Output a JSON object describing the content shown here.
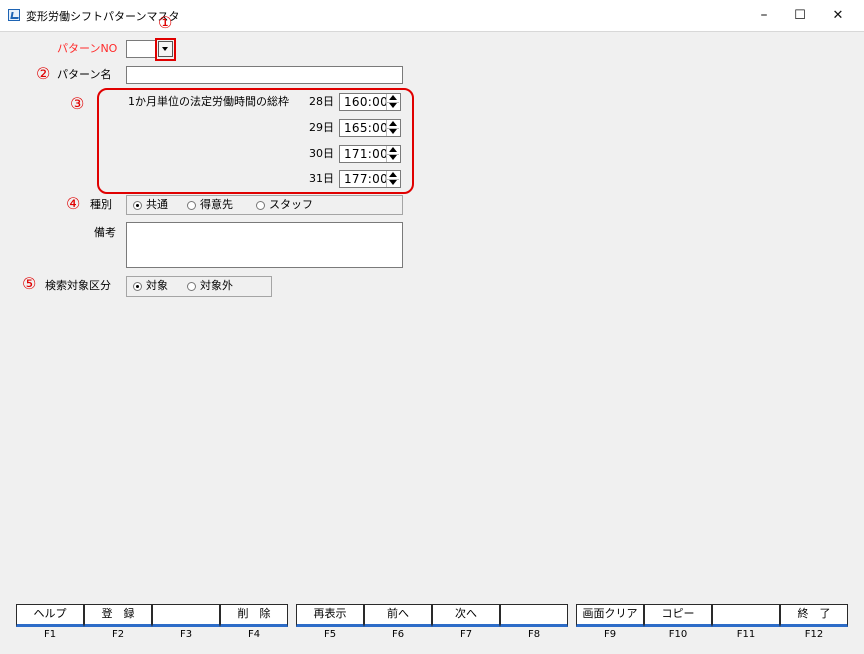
{
  "window": {
    "title": "変形労働シフトパターンマスタ",
    "controls": {
      "minimize": "–",
      "maximize": "☐",
      "close": "✕"
    }
  },
  "annotations": [
    "①",
    "②",
    "③",
    "④",
    "⑤"
  ],
  "pattern_no": {
    "label": "パターンNO",
    "value": ""
  },
  "pattern_name": {
    "label": "パターン名",
    "value": ""
  },
  "legal_hours": {
    "label": "1か月単位の法定労働時間の総枠",
    "rows": [
      {
        "day": "28日",
        "value": "160:00"
      },
      {
        "day": "29日",
        "value": "165:00"
      },
      {
        "day": "30日",
        "value": "171:00"
      },
      {
        "day": "31日",
        "value": "177:00"
      }
    ]
  },
  "category": {
    "label": "種別",
    "options": [
      "共通",
      "得意先",
      "スタッフ"
    ],
    "selected": "共通"
  },
  "remarks": {
    "label": "備考",
    "value": ""
  },
  "search_target": {
    "label": "検索対象区分",
    "options": [
      "対象",
      "対象外"
    ],
    "selected": "対象"
  },
  "function_keys": [
    {
      "label": "ヘルプ",
      "key": "F1"
    },
    {
      "label": "登　録",
      "key": "F2"
    },
    {
      "label": "",
      "key": "F3"
    },
    {
      "label": "削　除",
      "key": "F4"
    },
    {
      "label": "再表示",
      "key": "F5"
    },
    {
      "label": "前へ",
      "key": "F6"
    },
    {
      "label": "次へ",
      "key": "F7"
    },
    {
      "label": "",
      "key": "F8"
    },
    {
      "label": "画面クリア",
      "key": "F9"
    },
    {
      "label": "コピー",
      "key": "F10"
    },
    {
      "label": "",
      "key": "F11"
    },
    {
      "label": "終　了",
      "key": "F12"
    }
  ]
}
